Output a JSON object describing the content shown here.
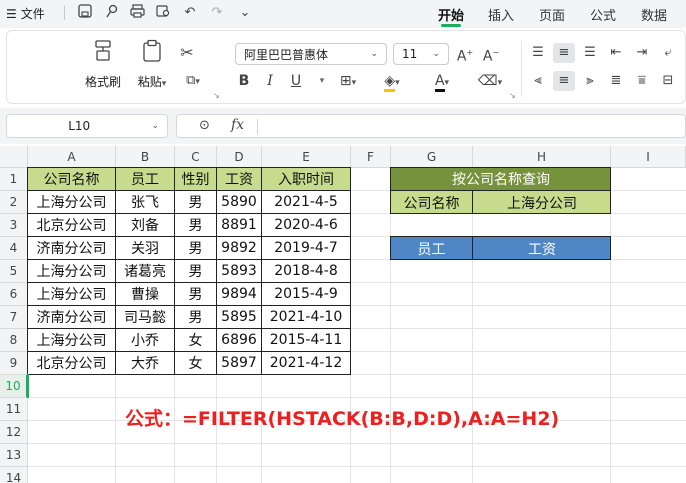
{
  "menu": {
    "file_label": "文件",
    "tabs": [
      {
        "label": "开始",
        "active": true
      },
      {
        "label": "插入"
      },
      {
        "label": "页面"
      },
      {
        "label": "公式"
      },
      {
        "label": "数据"
      }
    ]
  },
  "ribbon": {
    "format_painter": "格式刷",
    "paste": "粘贴",
    "font_name": "阿里巴巴普惠体",
    "font_size": "11",
    "bold": "B",
    "italic": "I",
    "underline": "U",
    "font_color_label": "A"
  },
  "formula_bar": {
    "name_box": "L10",
    "fx": "fx",
    "value": ""
  },
  "columns": [
    "A",
    "B",
    "C",
    "D",
    "E",
    "F",
    "G",
    "H",
    "I"
  ],
  "rows": [
    "1",
    "2",
    "3",
    "4",
    "5",
    "6",
    "7",
    "8",
    "9",
    "10",
    "11",
    "12",
    "13",
    "14"
  ],
  "table": {
    "headers": [
      "公司名称",
      "员工",
      "性别",
      "工资",
      "入职时间"
    ],
    "header_fill": "#c6dc8c",
    "rows": [
      [
        "上海分公司",
        "张飞",
        "男",
        "5890",
        "2021-4-5"
      ],
      [
        "北京分公司",
        "刘备",
        "男",
        "8891",
        "2020-4-6"
      ],
      [
        "济南分公司",
        "关羽",
        "男",
        "9892",
        "2019-4-7"
      ],
      [
        "上海分公司",
        "诸葛亮",
        "男",
        "5893",
        "2018-4-8"
      ],
      [
        "上海分公司",
        "曹操",
        "男",
        "9894",
        "2015-4-9"
      ],
      [
        "济南分公司",
        "司马懿",
        "男",
        "5895",
        "2021-4-10"
      ],
      [
        "上海分公司",
        "小乔",
        "女",
        "6896",
        "2015-4-11"
      ],
      [
        "北京分公司",
        "大乔",
        "女",
        "5897",
        "2021-4-12"
      ]
    ]
  },
  "query": {
    "title": "按公司名称查询",
    "title_fill": "#76923c",
    "label": "公司名称",
    "value": "上海分公司",
    "label_fill": "#c6dc8c",
    "result_headers": [
      "员工",
      "工资"
    ],
    "result_fill": "#4f86c6"
  },
  "note": "公式：=FILTER(HSTACK(B:B,D:D),A:A=H2)",
  "note_color": "#ee1f1f",
  "accent": "#1aaf5d"
}
